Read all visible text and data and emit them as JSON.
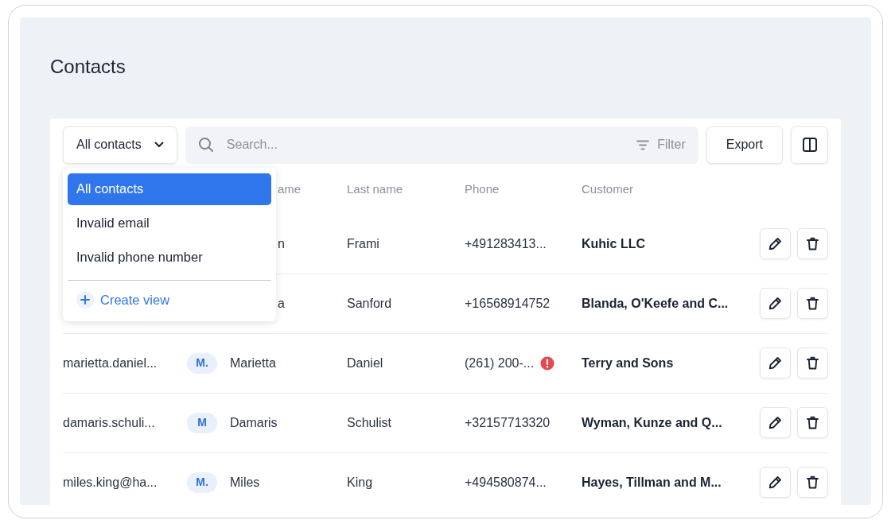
{
  "page": {
    "title": "Contacts"
  },
  "toolbar": {
    "view_button": "All contacts",
    "search": {
      "placeholder": "Search..."
    },
    "filter": "Filter",
    "export": "Export"
  },
  "view_menu": {
    "items": [
      {
        "label": "All contacts",
        "selected": true
      },
      {
        "label": "Invalid email",
        "selected": false
      },
      {
        "label": "Invalid phone number",
        "selected": false
      }
    ],
    "create": "Create view"
  },
  "table": {
    "columns": [
      {},
      {},
      {
        "label": "ame"
      },
      {
        "label": "Last name"
      },
      {
        "label": "Phone"
      },
      {
        "label": "Customer"
      }
    ],
    "rows": [
      {
        "first_name": "n",
        "last_name": "Frami",
        "phone": "+491283413...",
        "customer": "Kuhic LLC"
      },
      {
        "first_name": "a",
        "last_name": "Sanford",
        "phone": "+16568914752",
        "customer": "Blanda, O'Keefe and C..."
      },
      {
        "email": "marietta.daniel...",
        "avatar": "M.",
        "first_name": "Marietta",
        "last_name": "Daniel",
        "phone": "(261) 200-...",
        "phone_invalid": true,
        "customer": "Terry and Sons"
      },
      {
        "email": "damaris.schuli...",
        "avatar": "M",
        "first_name": "Damaris",
        "last_name": "Schulist",
        "phone": "+32157713320",
        "customer": "Wyman, Kunze and Q..."
      },
      {
        "email": "miles.king@ha...",
        "avatar": "M.",
        "first_name": "Miles",
        "last_name": "King",
        "phone": "+494580874...",
        "customer": "Hayes, Tillman and M..."
      }
    ]
  }
}
